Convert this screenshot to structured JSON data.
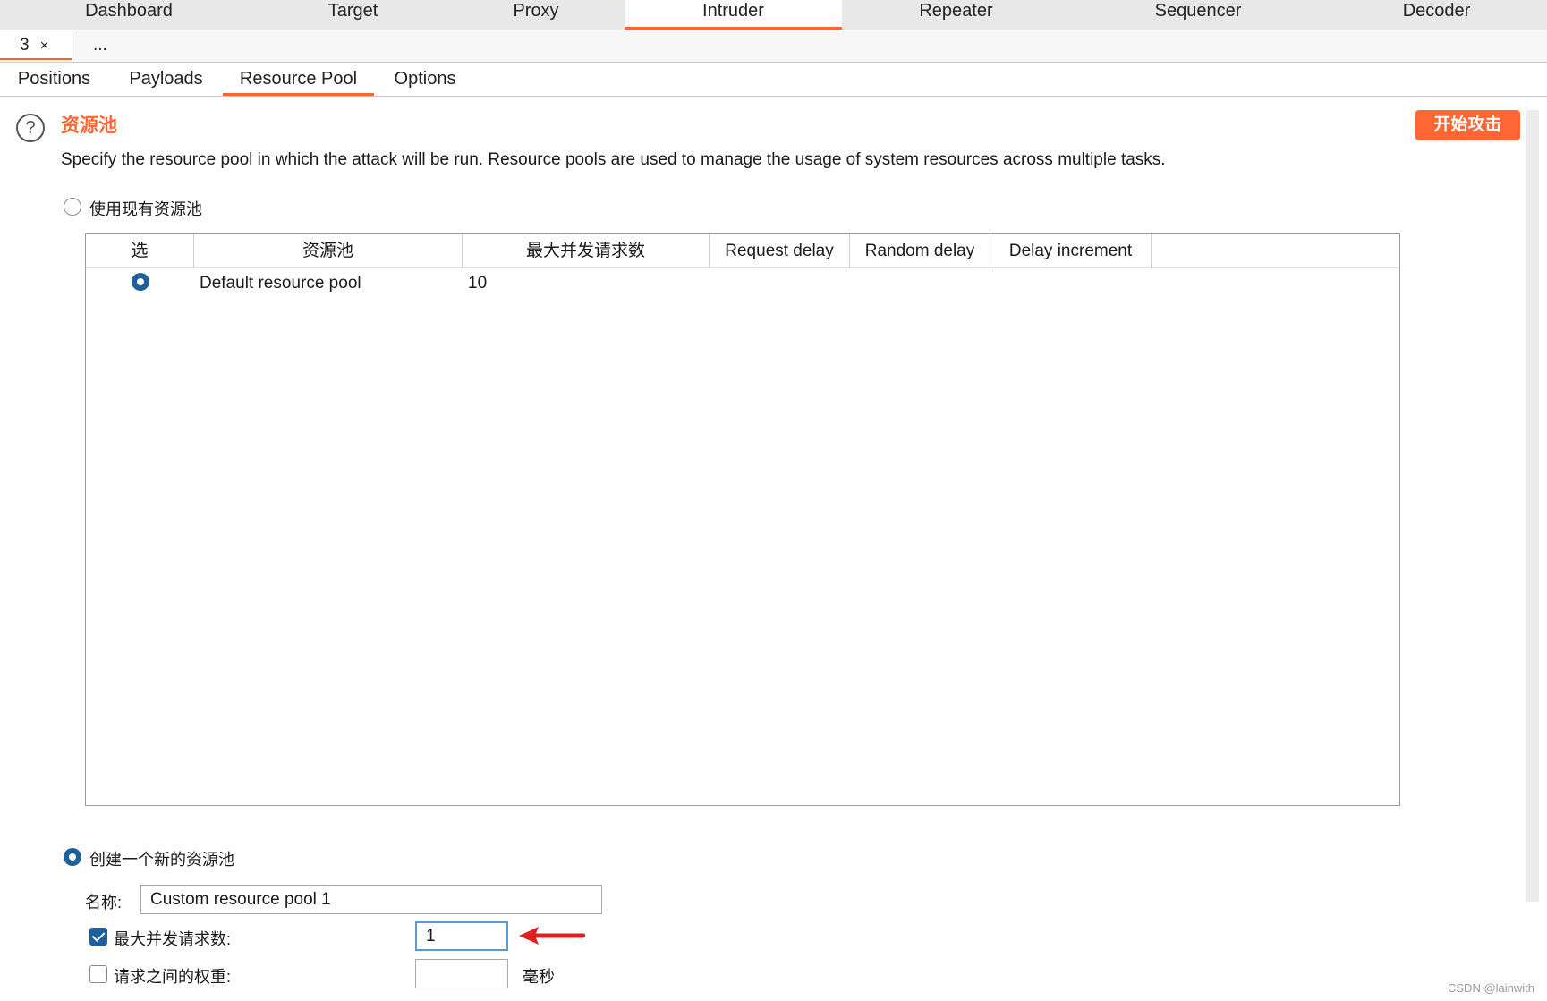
{
  "tool_tabs": [
    {
      "label": "Dashboard"
    },
    {
      "label": "Target"
    },
    {
      "label": "Proxy"
    },
    {
      "label": "Intruder",
      "active": true
    },
    {
      "label": "Repeater"
    },
    {
      "label": "Sequencer"
    },
    {
      "label": "Decoder"
    }
  ],
  "instance_tabs": {
    "first_label": "3",
    "close_glyph": "×",
    "more_label": "..."
  },
  "sub_tabs": [
    {
      "label": "Positions"
    },
    {
      "label": "Payloads"
    },
    {
      "label": "Resource Pool",
      "active": true
    },
    {
      "label": "Options"
    }
  ],
  "section": {
    "help_glyph": "?",
    "title": "资源池",
    "start_button": "开始攻击",
    "description": "Specify the resource pool in which the attack will be run. Resource pools are used to manage the usage of system resources across multiple tasks."
  },
  "existing_pool": {
    "label": "使用现有资源池",
    "selected": false,
    "columns": [
      "选",
      "资源池",
      "最大并发请求数",
      "Request delay",
      "Random delay",
      "Delay increment"
    ],
    "rows": [
      {
        "selected": true,
        "name": "Default resource pool",
        "max_concurrent": "10",
        "request_delay": "",
        "random_delay": "",
        "delay_increment": ""
      }
    ]
  },
  "new_pool": {
    "label": "创建一个新的资源池",
    "selected": true,
    "name_label": "名称:",
    "name_value": "Custom resource pool 1",
    "max_concurrent_label": "最大并发请求数:",
    "max_concurrent_checked": true,
    "max_concurrent_value": "1",
    "delay_label": "请求之间的权重:",
    "delay_checked": false,
    "delay_value": "",
    "delay_unit": "毫秒"
  },
  "annotation": {
    "arrow_color": "#e02020"
  },
  "colors": {
    "accent": "#ff6633",
    "radio_selected": "#1e5f9e"
  },
  "watermark": "CSDN @lainwith"
}
